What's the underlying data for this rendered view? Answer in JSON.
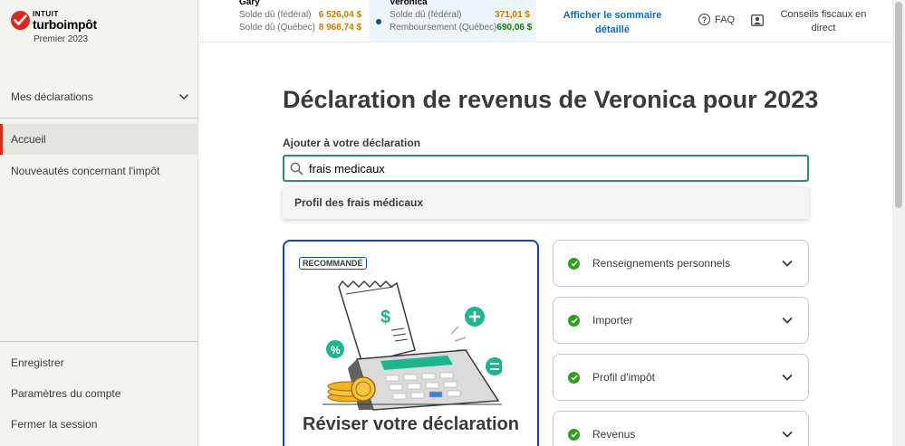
{
  "sidebar": {
    "logo": {
      "intuit": "INTUIT",
      "brand": "turboimpôt",
      "edition": "Premier 2023"
    },
    "mes_declarations": "Mes déclarations",
    "accueil": "Accueil",
    "nouveautes": "Nouveautés concernant l'impôt",
    "enregistrer": "Enregistrer",
    "parametres": "Paramètres du compte",
    "fermer": "Fermer la session"
  },
  "topbar": {
    "gary": {
      "name": "Gary",
      "row1_label": "Solde dû (fédéral)",
      "row1_amount": "6 526,04 $",
      "row2_label": "Solde dû (Québec)",
      "row2_amount": "8 968,74 $"
    },
    "veronica": {
      "name": "Veronica",
      "row1_label": "Solde dû (fédéral)",
      "row1_amount": "371,01 $",
      "row2_label": "Remboursement (Québec)",
      "row2_amount": "690,06 $"
    },
    "summary_link": "Afficher le sommaire détaillé",
    "faq": "FAQ",
    "expert": "Conseils fiscaux en direct"
  },
  "main": {
    "title": "Déclaration de revenus de Veronica pour 2023",
    "add_label": "Ajouter à votre déclaration",
    "search_value": "frais medicaux",
    "suggestion": "Profil des frais médicaux",
    "rec_badge": "RECOMMANDÉ",
    "rec_title": "Réviser votre déclaration",
    "accordions": [
      {
        "label": "Renseignements personnels"
      },
      {
        "label": "Importer"
      },
      {
        "label": "Profil d'impôt"
      },
      {
        "label": "Revenus"
      }
    ]
  },
  "colors": {
    "accent_red": "#d52b1e",
    "link_blue": "#0d6bbf",
    "card_border": "#0d4e9c",
    "search_border": "#2c8b7a",
    "owed": "#c77b00",
    "refund": "#108000",
    "check_green": "#2ca01c"
  },
  "icons": {
    "logo": "checkmark-logo-icon",
    "dropdown": "chevron-down-icon",
    "search": "search-icon",
    "faq": "question-circle-icon",
    "expert": "expert-portrait-icon",
    "complete": "checkmark-circle-icon"
  }
}
